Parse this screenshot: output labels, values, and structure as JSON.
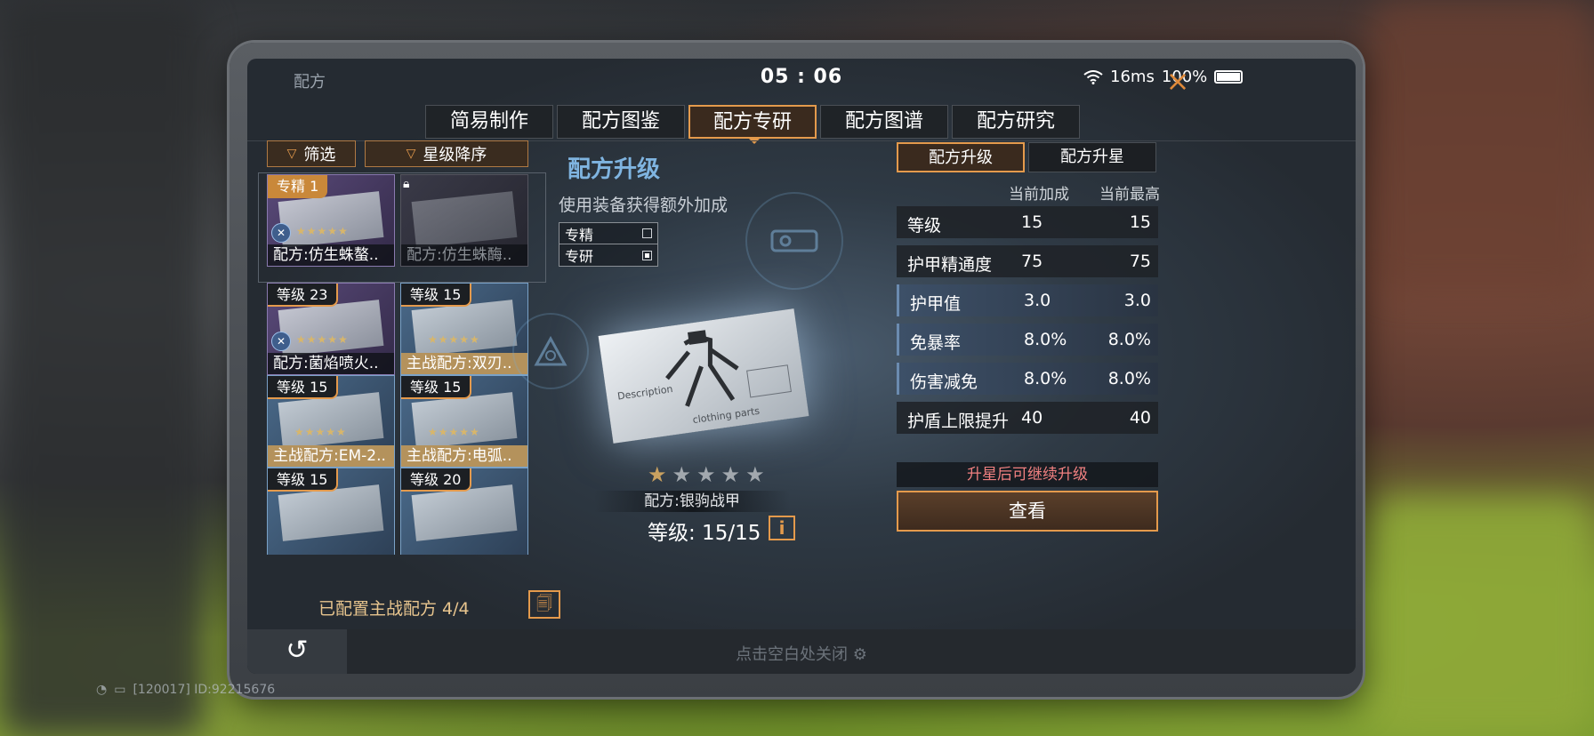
{
  "header": {
    "app_title": "配方",
    "time": "05 : 06",
    "ping": "16ms",
    "battery": "100%",
    "close_icon": "×"
  },
  "tabs": [
    {
      "label": "简易制作",
      "active": false
    },
    {
      "label": "配方图鉴",
      "active": false
    },
    {
      "label": "配方专研",
      "active": true
    },
    {
      "label": "配方图谱",
      "active": false
    },
    {
      "label": "配方研究",
      "active": false
    }
  ],
  "left": {
    "filter_label": "筛选",
    "sort_label": "星级降序",
    "cards": [
      {
        "badge": "专精 1",
        "name": "配方:仿生蛛螯..",
        "style": "purple"
      },
      {
        "badge": "",
        "name": "配方:仿生蛛酶..",
        "style": "dark",
        "locked": true
      },
      {
        "badge": "等级 23",
        "name": "配方:菌焰喷火..",
        "style": "purple"
      },
      {
        "badge": "等级 15",
        "name": "主战配方:双刃..",
        "style": "blue"
      },
      {
        "badge": "等级 15",
        "name": "主战配方:EM-2..",
        "style": "blue"
      },
      {
        "badge": "等级 15",
        "name": "主战配方:电弧..",
        "style": "blue"
      },
      {
        "badge": "等级 15",
        "name": "",
        "style": "blue"
      },
      {
        "badge": "等级 20",
        "name": "",
        "style": "blue"
      }
    ],
    "configured_text": "已配置主战配方 4/4"
  },
  "center": {
    "title": "配方升级",
    "subtitle": "使用装备获得额外加成",
    "modes": [
      {
        "label": "专精",
        "checked": false
      },
      {
        "label": "专研",
        "checked": true
      }
    ],
    "stars_filled": 1,
    "stars_total": 5,
    "item_name": "配方:银驹战甲",
    "level_text": "等级:  15/15",
    "info_icon": "i"
  },
  "right": {
    "tab_upgrade": "配方升级",
    "tab_star": "配方升星",
    "col_current": "当前加成",
    "col_max": "当前最高",
    "stats": [
      {
        "label": "等级",
        "current": "15",
        "max": "15",
        "highlight": false
      },
      {
        "label": "护甲精通度",
        "current": "75",
        "max": "75",
        "highlight": false
      },
      {
        "label": "护甲值",
        "current": "3.0",
        "max": "3.0",
        "highlight": true
      },
      {
        "label": "免暴率",
        "current": "8.0%",
        "max": "8.0%",
        "highlight": true
      },
      {
        "label": "伤害减免",
        "current": "8.0%",
        "max": "8.0%",
        "highlight": true
      },
      {
        "label": "护盾上限提升",
        "current": "40",
        "max": "40",
        "highlight": false
      }
    ],
    "note": "升星后可继续升级",
    "view_button": "查看"
  },
  "bottom": {
    "back_icon": "↺",
    "close_hint": "点击空白处关闭"
  },
  "debug_text": "[120017] ID:92215676",
  "colors": {
    "accent": "#e49a4c",
    "title_blue": "#7fb4e0",
    "note_red": "#f08080"
  }
}
